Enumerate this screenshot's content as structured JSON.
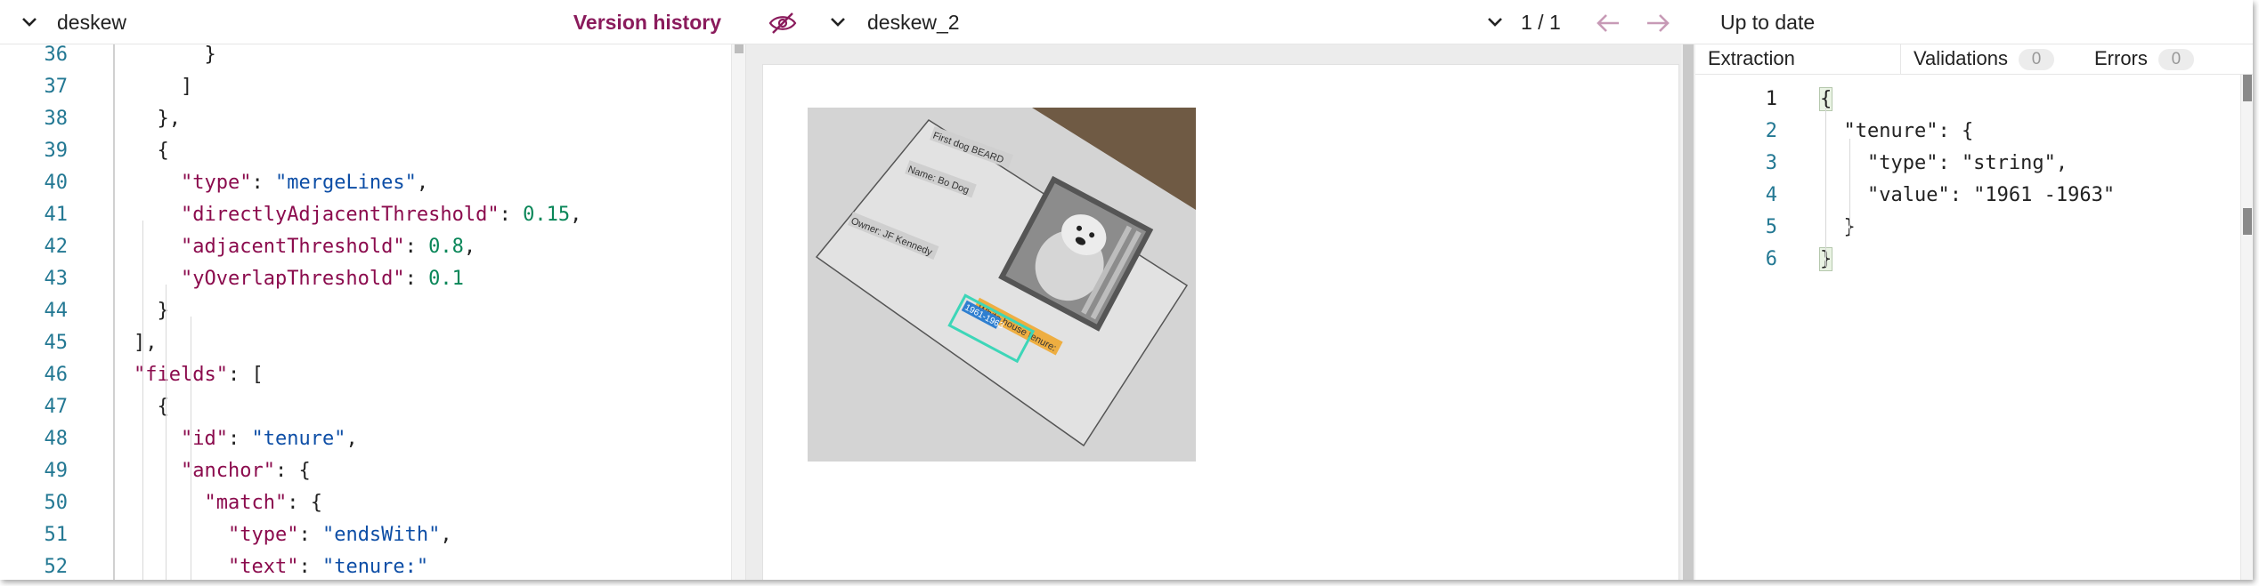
{
  "left": {
    "file_name": "deskew",
    "version_history_label": "Version history",
    "lines": [
      {
        "num": "36",
        "segments": [
          {
            "t": "punc",
            "v": "      }"
          }
        ]
      },
      {
        "num": "37",
        "segments": [
          {
            "t": "punc",
            "v": "    ]"
          }
        ]
      },
      {
        "num": "38",
        "segments": [
          {
            "t": "punc",
            "v": "  },"
          }
        ]
      },
      {
        "num": "39",
        "segments": [
          {
            "t": "punc",
            "v": "  {"
          }
        ]
      },
      {
        "num": "40",
        "segments": [
          {
            "t": "punc",
            "v": "    "
          },
          {
            "t": "key",
            "v": "\"type\""
          },
          {
            "t": "punc",
            "v": ": "
          },
          {
            "t": "str",
            "v": "\"mergeLines\""
          },
          {
            "t": "punc",
            "v": ","
          }
        ]
      },
      {
        "num": "41",
        "segments": [
          {
            "t": "punc",
            "v": "    "
          },
          {
            "t": "key",
            "v": "\"directlyAdjacentThreshold\""
          },
          {
            "t": "punc",
            "v": ": "
          },
          {
            "t": "num",
            "v": "0.15"
          },
          {
            "t": "punc",
            "v": ","
          }
        ]
      },
      {
        "num": "42",
        "segments": [
          {
            "t": "punc",
            "v": "    "
          },
          {
            "t": "key",
            "v": "\"adjacentThreshold\""
          },
          {
            "t": "punc",
            "v": ": "
          },
          {
            "t": "num",
            "v": "0.8"
          },
          {
            "t": "punc",
            "v": ","
          }
        ]
      },
      {
        "num": "43",
        "segments": [
          {
            "t": "punc",
            "v": "    "
          },
          {
            "t": "key",
            "v": "\"yOverlapThreshold\""
          },
          {
            "t": "punc",
            "v": ": "
          },
          {
            "t": "num",
            "v": "0.1"
          }
        ]
      },
      {
        "num": "44",
        "segments": [
          {
            "t": "punc",
            "v": "  }"
          }
        ]
      },
      {
        "num": "45",
        "segments": [
          {
            "t": "punc",
            "v": "],"
          }
        ]
      },
      {
        "num": "46",
        "segments": [
          {
            "t": "key",
            "v": "\"fields\""
          },
          {
            "t": "punc",
            "v": ": ["
          }
        ]
      },
      {
        "num": "47",
        "segments": [
          {
            "t": "punc",
            "v": "  {"
          }
        ]
      },
      {
        "num": "48",
        "segments": [
          {
            "t": "punc",
            "v": "    "
          },
          {
            "t": "key",
            "v": "\"id\""
          },
          {
            "t": "punc",
            "v": ": "
          },
          {
            "t": "str",
            "v": "\"tenure\""
          },
          {
            "t": "punc",
            "v": ","
          }
        ]
      },
      {
        "num": "49",
        "segments": [
          {
            "t": "punc",
            "v": "    "
          },
          {
            "t": "key",
            "v": "\"anchor\""
          },
          {
            "t": "punc",
            "v": ": {"
          }
        ]
      },
      {
        "num": "50",
        "segments": [
          {
            "t": "punc",
            "v": "      "
          },
          {
            "t": "key",
            "v": "\"match\""
          },
          {
            "t": "punc",
            "v": ": {"
          }
        ]
      },
      {
        "num": "51",
        "segments": [
          {
            "t": "punc",
            "v": "        "
          },
          {
            "t": "key",
            "v": "\"type\""
          },
          {
            "t": "punc",
            "v": ": "
          },
          {
            "t": "str",
            "v": "\"endsWith\""
          },
          {
            "t": "punc",
            "v": ","
          }
        ]
      },
      {
        "num": "52",
        "segments": [
          {
            "t": "punc",
            "v": "        "
          },
          {
            "t": "key",
            "v": "\"text\""
          },
          {
            "t": "punc",
            "v": ": "
          },
          {
            "t": "str",
            "v": "\"tenure:\""
          }
        ]
      }
    ]
  },
  "middle": {
    "file_name": "deskew_2",
    "page_count": "1 / 1",
    "photo_card": {
      "lines": [
        "First dog BEARD",
        "Name: Bo Dog",
        "Owner: JF Kennedy",
        "White house tenure:",
        "1961-1963"
      ]
    },
    "colors": {
      "anchor_box": "#f0a830",
      "value_box": "#3dd6b8",
      "value_fill": "#2f7fd0"
    }
  },
  "right": {
    "status": "Up to date",
    "tabs": {
      "extraction": "Extraction",
      "validations": "Validations",
      "validations_count": "0",
      "errors": "Errors",
      "errors_count": "0"
    },
    "lines": [
      {
        "num": "1",
        "text": "{"
      },
      {
        "num": "2",
        "text": "  \"tenure\": {"
      },
      {
        "num": "3",
        "text": "    \"type\": \"string\","
      },
      {
        "num": "4",
        "text": "    \"value\": \"1961 -1963\""
      },
      {
        "num": "5",
        "text": "  }"
      },
      {
        "num": "6",
        "text": "}"
      }
    ]
  }
}
